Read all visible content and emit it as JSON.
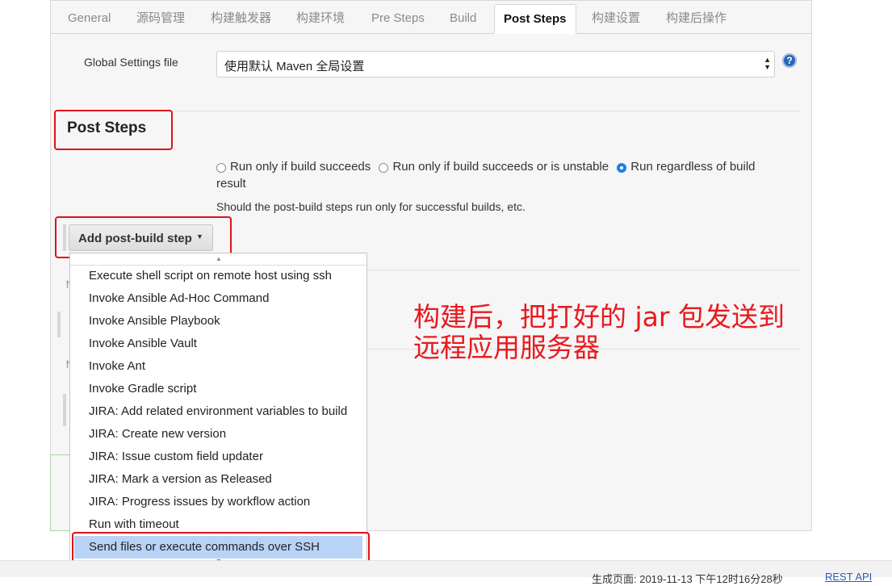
{
  "tabs": [
    {
      "label": "General"
    },
    {
      "label": "源码管理"
    },
    {
      "label": "构建触发器"
    },
    {
      "label": "构建环境"
    },
    {
      "label": "Pre Steps"
    },
    {
      "label": "Build"
    },
    {
      "label": "Post Steps"
    },
    {
      "label": "构建设置"
    },
    {
      "label": "构建后操作"
    }
  ],
  "active_tab": "Post Steps",
  "global_settings": {
    "label": "Global Settings file",
    "value": "使用默认 Maven 全局设置",
    "help": "?"
  },
  "post_steps": {
    "title": "Post Steps",
    "radios": [
      {
        "label": "Run only if build succeeds",
        "checked": false
      },
      {
        "label": "Run only if build succeeds or is unstable",
        "checked": false
      },
      {
        "label": "Run regardless of build result",
        "checked": true
      }
    ],
    "hint": "Should the post-build steps run only for successful builds, etc.",
    "add_button": "Add post-build step"
  },
  "dropdown": {
    "items": [
      "Execute shell script on remote host using ssh",
      "Invoke Ansible Ad-Hoc Command",
      "Invoke Ansible Playbook",
      "Invoke Ansible Vault",
      "Invoke Ant",
      "Invoke Gradle script",
      "JIRA: Add related environment variables to build",
      "JIRA: Create new version",
      "JIRA: Issue custom field updater",
      "JIRA: Mark a version as Released",
      "JIRA: Progress issues by workflow action",
      "Run with timeout",
      "Send files or execute commands over SSH"
    ],
    "highlighted_index": 12
  },
  "annotation": {
    "line1": "构建后，把打好的 jar 包发送到",
    "line2": "远程应用服务器"
  },
  "footer": {
    "generated": "生成页面: 2019-11-13 下午12时16分28秒",
    "rest_api": "REST API"
  },
  "colors": {
    "annotation_red": "#e8191f",
    "highlight": "#b9d3f7",
    "radio_checked": "#1e7ee9"
  }
}
